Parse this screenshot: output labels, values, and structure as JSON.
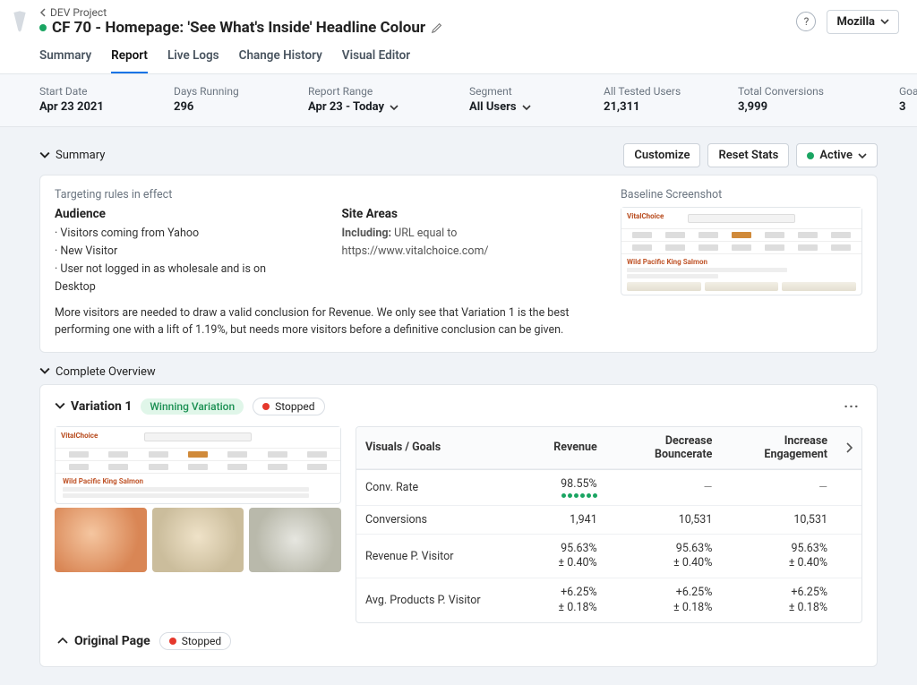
{
  "breadcrumb": {
    "project": "DEV Project"
  },
  "title": "CF 70 - Homepage: 'See What's Inside' Headline Colour",
  "account": "Mozilla",
  "tabs": [
    {
      "label": "Summary",
      "active": false
    },
    {
      "label": "Report",
      "active": true
    },
    {
      "label": "Live Logs",
      "active": false
    },
    {
      "label": "Change History",
      "active": false
    },
    {
      "label": "Visual Editor",
      "active": false
    }
  ],
  "info": {
    "start_date_label": "Start Date",
    "start_date_value": "Apr 23 2021",
    "days_running_label": "Days Running",
    "days_running_value": "296",
    "report_range_label": "Report Range",
    "report_range_value": "Apr 23 - Today",
    "segment_label": "Segment",
    "segment_value": "All Users",
    "tested_users_label": "All Tested Users",
    "tested_users_value": "21,311",
    "total_conversions_label": "Total Conversions",
    "total_conversions_value": "3,999",
    "goals_label": "Goals",
    "goals_value": "3"
  },
  "btns": {
    "customize": "Customize",
    "reset_stats": "Reset Stats",
    "active": "Active"
  },
  "summary_section_title": "Summary",
  "summary": {
    "rules_label": "Targeting rules in effect",
    "audience_title": "Audience",
    "audience_lines": [
      "· Visitors coming from Yahoo",
      "· New Visitor",
      "· User not logged in as wholesale and is on Desktop"
    ],
    "sitearea_title": "Site Areas",
    "sitearea_prefix": "Including:",
    "sitearea_text": " URL equal to https://www.vitalchoice.com/",
    "conclusion": "More visitors are needed to draw a valid conclusion for Revenue. We only see that Variation 1 is the best performing one with a lift of 1.19%, but needs more visitors before a definitive conclusion can be given.",
    "baseline_label": "Baseline Screenshot",
    "thumb_title": "Wild Pacific King Salmon"
  },
  "overview_title": "Complete Overview",
  "variation": {
    "name": "Variation 1",
    "winning_label": "Winning Variation",
    "stopped_label": "Stopped",
    "columns": {
      "visual_goals": "Visuals / Goals",
      "revenue": "Revenue",
      "decrease_br": "Decrease Bouncerate",
      "increase_eng": "Increase Engagement"
    },
    "rows": {
      "conv_rate_label": "Conv. Rate",
      "conv_rate_revenue": "98.55%",
      "conversions_label": "Conversions",
      "conversions_revenue": "1,941",
      "conversions_br": "10,531",
      "conversions_eng": "10,531",
      "rpv_label": "Revenue P. Visitor",
      "rpv_v1": "95.63%",
      "rpv_v2": "± 0.40%",
      "avg_label": "Avg. Products P. Visitor",
      "avg_v1": "+6.25%",
      "avg_v2": "± 0.18%"
    },
    "thumb_title": "Wild Pacific King Salmon"
  },
  "original": {
    "name": "Original Page",
    "stopped_label": "Stopped"
  },
  "mdash": "—"
}
